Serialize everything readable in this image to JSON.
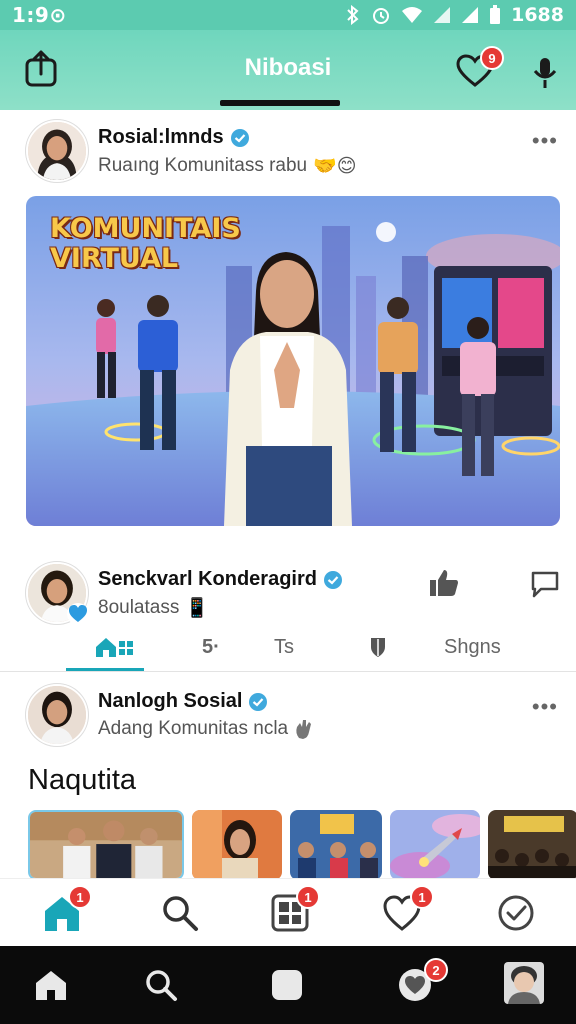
{
  "status_bar": {
    "time": "1:9⊙",
    "battery_text": "1688"
  },
  "app_bar": {
    "title": "Niboasi",
    "notification_count": "9"
  },
  "post1": {
    "name": "Rosial:lmnds",
    "subtitle": "Ruaıng Komunitass rabu",
    "emoji": "🤝😊",
    "more": "•••",
    "hero_title_line1": "KOMUNITAIS",
    "hero_title_line2": "VIRTUAL"
  },
  "post2": {
    "name": "Senckvarl Konderagird",
    "subtitle": "8oulatass",
    "emoji": "📱"
  },
  "tabs": {
    "tab2": "5·",
    "tab3": "Ts",
    "tab5": "Shgns"
  },
  "post3": {
    "name": "Nanlogh Sosial",
    "subtitle": "Adang Komunitas ncla",
    "more": "•••",
    "section_title": "Naqutita"
  },
  "bottom_nav": {
    "home_badge": "1",
    "grid_badge": "1",
    "heart_badge": "1"
  },
  "system_nav": {
    "heart_badge": "2"
  },
  "colors": {
    "accent": "#5ccbb0",
    "badge": "#e53935",
    "tab_active": "#19a6b8"
  }
}
